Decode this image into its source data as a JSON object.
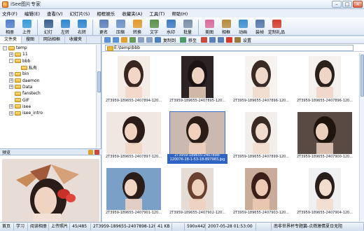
{
  "window": {
    "title": "iSee图片专家"
  },
  "menu": [
    "文件(F)",
    "编辑(E)",
    "查看(V)",
    "幻灯片(S)",
    "相框娱乐",
    "收藏夹(A)",
    "工具(T)",
    "帮助(H)"
  ],
  "toolbar": [
    {
      "label": "相册",
      "icon": "album-icon",
      "color": "#4f7fc9"
    },
    {
      "label": "上传",
      "icon": "upload-icon",
      "color": "#3a9ad8"
    },
    {
      "sep": true
    },
    {
      "label": "幻灯",
      "icon": "slideshow-icon",
      "color": "#3b5f8f"
    },
    {
      "label": "左转",
      "icon": "rotate-left-icon",
      "color": "#2f86d0"
    },
    {
      "label": "右转",
      "icon": "rotate-right-icon",
      "color": "#2f86d0"
    },
    {
      "sep": true
    },
    {
      "label": "更名",
      "icon": "rename-icon",
      "color": "#5a7fb8"
    },
    {
      "label": "压缩",
      "icon": "compress-icon",
      "color": "#6b91c6"
    },
    {
      "label": "转换",
      "icon": "convert-icon",
      "color": "#e19a2a"
    },
    {
      "label": "文字",
      "icon": "text-icon",
      "color": "#5a8f4a"
    },
    {
      "label": "水印",
      "icon": "watermark-icon",
      "color": "#3d7ac0"
    },
    {
      "label": "批量",
      "icon": "batch-icon",
      "color": "#7a8ea8"
    },
    {
      "sep": true
    },
    {
      "label": "美图",
      "icon": "beautify-icon",
      "color": "#d86a9a"
    },
    {
      "label": "相框",
      "icon": "frame-icon",
      "color": "#b68a3a"
    },
    {
      "label": "动画",
      "icon": "animation-icon",
      "color": "#3e8ed0"
    },
    {
      "label": "装帧",
      "icon": "mount-icon",
      "color": "#5577aa"
    },
    {
      "label": "定制礼品",
      "icon": "gift-icon",
      "color": "#d33a2c"
    }
  ],
  "left_tabs": [
    "文件夹",
    "搜图",
    "网站相框",
    "收藏夹"
  ],
  "tree": [
    {
      "label": "temp",
      "depth": 0,
      "expand": "-"
    },
    {
      "label": "11",
      "depth": 1,
      "expand": "+"
    },
    {
      "label": "bbb",
      "depth": 1,
      "expand": "-"
    },
    {
      "label": "私有",
      "depth": 2,
      "expand": ""
    },
    {
      "label": "bin",
      "depth": 1,
      "expand": "+"
    },
    {
      "label": "daemon",
      "depth": 1,
      "expand": "+"
    },
    {
      "label": "Data",
      "depth": 1,
      "expand": "+"
    },
    {
      "label": "fanstech",
      "depth": 1,
      "expand": ""
    },
    {
      "label": "GIF",
      "depth": 1,
      "expand": ""
    },
    {
      "label": "isee",
      "depth": 1,
      "expand": "+"
    },
    {
      "label": "isee_intro",
      "depth": 1,
      "expand": "+"
    }
  ],
  "preview": {
    "label": "预览"
  },
  "subtoolbar": {
    "copy_label": "复制到",
    "move_label": "移至",
    "settings_label": "设置"
  },
  "address": "E:\\temp\\bbb",
  "thumbnails": [
    {
      "caption": "2T3959-189655-2407894-120..."
    },
    {
      "caption": "2T3959-189655-2407895-120..."
    },
    {
      "caption": "2T3959-189655-2407896-120..."
    },
    {
      "caption": "2T3959-189655-2407896-120..."
    },
    {
      "caption": "2T3959-189655-2407897-120..."
    },
    {
      "caption": "2T3959-189655-2407898-120076-28-1-53-18-897983.jpg",
      "selected": true
    },
    {
      "caption": "2T3959-189655-2407899-120..."
    },
    {
      "caption": "2T3959-189655-2407900-120..."
    },
    {
      "caption": "2T3959-189655-2407901-120..."
    },
    {
      "caption": "2T3959-189655-2407902-120..."
    },
    {
      "caption": "2T3959-189655-2407903-120..."
    },
    {
      "caption": "2T3959-189655-2407904-120..."
    }
  ],
  "status": [
    "首页",
    "学习",
    "阅读相册",
    "上传照片",
    "45/485",
    "2T3959-189655-2407898-120076-(...",
    "41 KB",
    "",
    "590x442",
    "2007-05-28 01:53:00",
    "",
    "南非世界杯专题篇-点燃激情夏日无阻"
  ],
  "colors": {
    "accent": "#2f63c4",
    "window_bg": "#cfdcee"
  }
}
